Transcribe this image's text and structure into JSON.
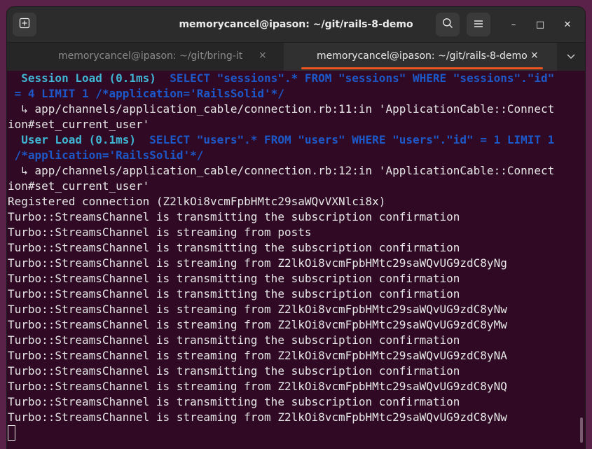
{
  "window": {
    "title": "memorycancel@ipason: ~/git/rails-8-demo",
    "new_tab_icon": "new-tab-icon",
    "search_icon": "search-icon",
    "menu_icon": "hamburger-menu-icon",
    "minimize": "–",
    "maximize": "□",
    "close": "✕"
  },
  "tabs": [
    {
      "label": "memorycancel@ipason: ~/git/bring-it",
      "close": "×",
      "active": false
    },
    {
      "label": "memorycancel@ipason: ~/git/rails-8-demo",
      "close": "×",
      "active": true
    }
  ],
  "tab_menu": "⌄",
  "colors": {
    "accent": "#e95420",
    "terminal_bg": "#300a24",
    "sql_name": "#3fb6d4",
    "sql_body": "#1d58c9"
  },
  "terminal": {
    "lines": [
      {
        "parts": [
          {
            "text": "  Session Load (0.1ms)",
            "style": "cyan"
          },
          {
            "text": "  SELECT \"sessions\".* FROM \"sessions\" WHERE \"sessions\".\"id\"",
            "style": "blue"
          }
        ]
      },
      {
        "parts": [
          {
            "text": " = 4 LIMIT 1 /*application='RailsSolid'*/",
            "style": "blue"
          }
        ]
      },
      {
        "parts": [
          {
            "text": "  ↳ app/channels/application_cable/connection.rb:11:in 'ApplicationCable::Connect",
            "style": "plain"
          }
        ]
      },
      {
        "parts": [
          {
            "text": "ion#set_current_user'",
            "style": "plain"
          }
        ]
      },
      {
        "parts": [
          {
            "text": "  User Load (0.1ms)",
            "style": "cyan"
          },
          {
            "text": "  SELECT \"users\".* FROM \"users\" WHERE \"users\".\"id\" = 1 LIMIT 1",
            "style": "blue"
          }
        ]
      },
      {
        "parts": [
          {
            "text": " /*application='RailsSolid'*/",
            "style": "blue"
          }
        ]
      },
      {
        "parts": [
          {
            "text": "  ↳ app/channels/application_cable/connection.rb:12:in 'ApplicationCable::Connect",
            "style": "plain"
          }
        ]
      },
      {
        "parts": [
          {
            "text": "ion#set_current_user'",
            "style": "plain"
          }
        ]
      },
      {
        "parts": [
          {
            "text": "Registered connection (Z2lkOi8vcmFpbHMtc29saWQvVXNlci8x)",
            "style": "plain"
          }
        ]
      },
      {
        "parts": [
          {
            "text": "Turbo::StreamsChannel is transmitting the subscription confirmation",
            "style": "plain"
          }
        ]
      },
      {
        "parts": [
          {
            "text": "Turbo::StreamsChannel is streaming from posts",
            "style": "plain"
          }
        ]
      },
      {
        "parts": [
          {
            "text": "Turbo::StreamsChannel is transmitting the subscription confirmation",
            "style": "plain"
          }
        ]
      },
      {
        "parts": [
          {
            "text": "Turbo::StreamsChannel is streaming from Z2lkOi8vcmFpbHMtc29saWQvUG9zdC8yNg",
            "style": "plain"
          }
        ]
      },
      {
        "parts": [
          {
            "text": "Turbo::StreamsChannel is transmitting the subscription confirmation",
            "style": "plain"
          }
        ]
      },
      {
        "parts": [
          {
            "text": "Turbo::StreamsChannel is transmitting the subscription confirmation",
            "style": "plain"
          }
        ]
      },
      {
        "parts": [
          {
            "text": "Turbo::StreamsChannel is streaming from Z2lkOi8vcmFpbHMtc29saWQvUG9zdC8yNw",
            "style": "plain"
          }
        ]
      },
      {
        "parts": [
          {
            "text": "Turbo::StreamsChannel is streaming from Z2lkOi8vcmFpbHMtc29saWQvUG9zdC8yMw",
            "style": "plain"
          }
        ]
      },
      {
        "parts": [
          {
            "text": "Turbo::StreamsChannel is transmitting the subscription confirmation",
            "style": "plain"
          }
        ]
      },
      {
        "parts": [
          {
            "text": "Turbo::StreamsChannel is streaming from Z2lkOi8vcmFpbHMtc29saWQvUG9zdC8yNA",
            "style": "plain"
          }
        ]
      },
      {
        "parts": [
          {
            "text": "Turbo::StreamsChannel is transmitting the subscription confirmation",
            "style": "plain"
          }
        ]
      },
      {
        "parts": [
          {
            "text": "Turbo::StreamsChannel is streaming from Z2lkOi8vcmFpbHMtc29saWQvUG9zdC8yNQ",
            "style": "plain"
          }
        ]
      },
      {
        "parts": [
          {
            "text": "Turbo::StreamsChannel is transmitting the subscription confirmation",
            "style": "plain"
          }
        ]
      },
      {
        "parts": [
          {
            "text": "Turbo::StreamsChannel is streaming from Z2lkOi8vcmFpbHMtc29saWQvUG9zdC8yNw",
            "style": "plain"
          }
        ]
      }
    ]
  }
}
